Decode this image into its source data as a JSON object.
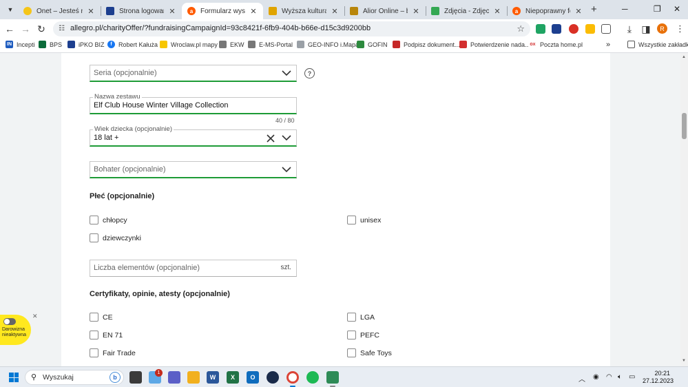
{
  "tabs": [
    {
      "title": "Onet – Jesteś na bieżąco",
      "active": false
    },
    {
      "title": "Strona logowania | iPKO",
      "active": false
    },
    {
      "title": "Formularz wystawiania",
      "active": true
    },
    {
      "title": "Wyższa kultura. Bankowość",
      "active": false
    },
    {
      "title": "Alior Online – bankowość",
      "active": false
    },
    {
      "title": "Zdjęcia - Zdjęcia Google",
      "active": false
    },
    {
      "title": "Niepoprawny formularz",
      "active": false
    }
  ],
  "address": {
    "url": "allegro.pl/charityOffer/?fundraisingCampaignId=93c8421f-6fb9-404b-b66e-d15c3d9200bb"
  },
  "profile_initial": "R",
  "bookmarks": [
    {
      "label": "Incepti"
    },
    {
      "label": "BPS"
    },
    {
      "label": "iPKO BIZ"
    },
    {
      "label": "Robert Kałuża"
    },
    {
      "label": "Wroclaw.pl mapy"
    },
    {
      "label": "EKW"
    },
    {
      "label": "E-MS-Portal"
    },
    {
      "label": "GEO-INFO i.Mapa"
    },
    {
      "label": "GOFIN"
    },
    {
      "label": "Podpisz dokument..."
    },
    {
      "label": "Potwierdzenie nada..."
    },
    {
      "label": "Poczta home.pl"
    }
  ],
  "bookmarks_more": "»",
  "all_bookmarks": "Wszystkie zakładki",
  "form": {
    "seria": {
      "placeholder": "Seria (opcjonalnie)"
    },
    "nazwa": {
      "label": "Nazwa zestawu",
      "value": "Elf Club House Winter Village Collection",
      "counter": "40  /  80"
    },
    "wiek": {
      "label": "Wiek dziecka (opcjonalnie)",
      "value": "18 lat +"
    },
    "bohater": {
      "placeholder": "Bohater (opcjonalnie)"
    },
    "plec": {
      "title": "Płeć (opcjonalnie)",
      "options": [
        {
          "label": "chłopcy"
        },
        {
          "label": "unisex"
        },
        {
          "label": "dziewczynki"
        }
      ]
    },
    "liczba": {
      "placeholder": "Liczba elementów (opcjonalnie)",
      "unit": "szt."
    },
    "cert": {
      "title": "Certyfikaty, opinie, atesty (opcjonalnie)",
      "options": [
        {
          "label": "CE"
        },
        {
          "label": "LGA"
        },
        {
          "label": "EN 71"
        },
        {
          "label": "PEFC"
        },
        {
          "label": "Fair Trade"
        },
        {
          "label": "Safe Toys"
        }
      ]
    }
  },
  "donate_badge": {
    "text": "Darowizna nieaktywna"
  },
  "taskbar": {
    "search_label": "Wyszukaj",
    "notification_count": "1",
    "time": "20:21",
    "date": "27.12.2023"
  }
}
